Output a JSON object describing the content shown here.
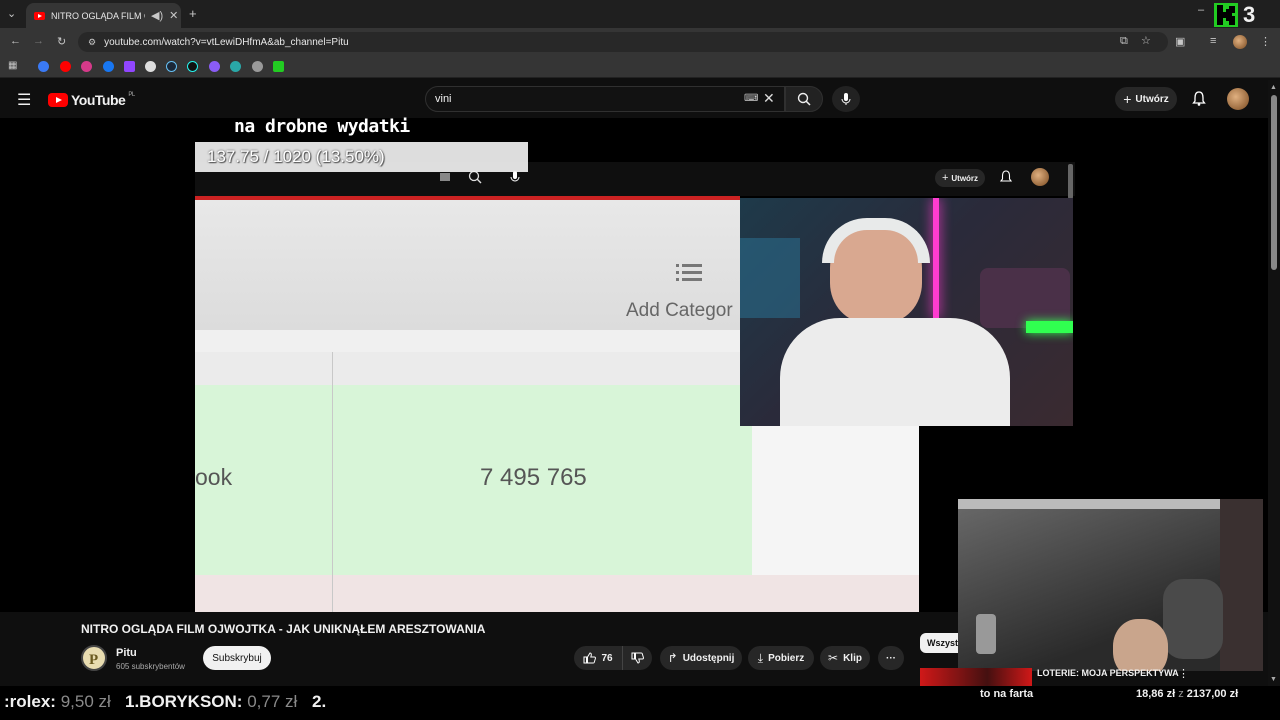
{
  "browser": {
    "tab_title": "NITRO OGLĄDA FILM OJWOJTKA - JAK UNIKNĄŁEM ARESZTOWANIA",
    "url": "youtube.com/watch?v=vtLewiDHfmA&ab_channel=Pitu",
    "overlay_corner": "3"
  },
  "youtube": {
    "logo_text": "YouTube",
    "region": "PL",
    "search_value": "vini",
    "create_label": "Utwórz"
  },
  "video_overlay": {
    "label": "na drobne wydatki",
    "progress_text": "137.75 / 1020 (13.50%)",
    "progress": {
      "current": 137.75,
      "target": 1020,
      "percent": 13.5
    },
    "inner_create_label": "Utwórz",
    "add_category_text": "Add Categor",
    "cell_left_text": "ook",
    "cell_value_text": "7 495 765"
  },
  "video_info": {
    "title": "NITRO OGLĄDA FILM OJWOJTKA - JAK UNIKNĄŁEM ARESZTOWANIA",
    "channel_name": "Pitu",
    "subscribers": "605 subskrybentów",
    "subscribe_label": "Subskrybuj",
    "likes": "76",
    "share_label": "Udostępnij",
    "download_label": "Pobierz",
    "clip_label": "Klip",
    "more_label": "···",
    "chip_label": "Wszyst"
  },
  "recommendation": {
    "title": "LOTERIE: MOJA PERSPEKTYWA",
    "menu": "⋮"
  },
  "ticker": {
    "item1_name": ":rolex:",
    "item1_amount": "9,50 zł",
    "item2_name": "1.BORYKSON:",
    "item2_amount": "0,77 zł",
    "item3_name": "2.",
    "center_text": "to na farta",
    "goal_current": "18,86 zł",
    "goal_separator": "z",
    "goal_total": "2137,00 zł"
  },
  "colors": {
    "youtube_red": "#ff0000",
    "progress_box": "#f0f0f0",
    "sheet_green": "#d8f5d8"
  }
}
